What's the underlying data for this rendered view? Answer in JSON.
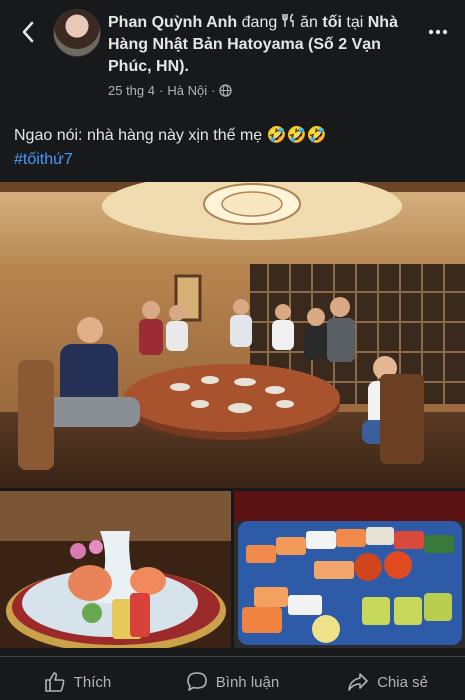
{
  "post": {
    "author": "Phan Quỳnh Anh",
    "activity_prefix": "đang",
    "activity_icon": "fork-knife-icon",
    "activity_word": "ăn",
    "activity_bold": "tối",
    "activity_suffix": "tại",
    "place": "Nhà Hàng Nhật Bản Hatoyama (Số 2 Vạn Phúc, HN).",
    "date": "25 thg 4",
    "separator": "·",
    "location": "Hà Nội",
    "privacy_icon": "globe-icon",
    "caption": "Ngao nói: nhà hàng này xịn thế mẹ 🤣🤣🤣",
    "hashtag": "#tốithứ7"
  },
  "actions": {
    "like_label": "Thích",
    "comment_label": "Bình luận",
    "share_label": "Chia sẻ"
  },
  "colors": {
    "background": "#18191a",
    "text": "#e4e6eb",
    "secondary": "#b0b3b8",
    "link": "#4599ff"
  }
}
